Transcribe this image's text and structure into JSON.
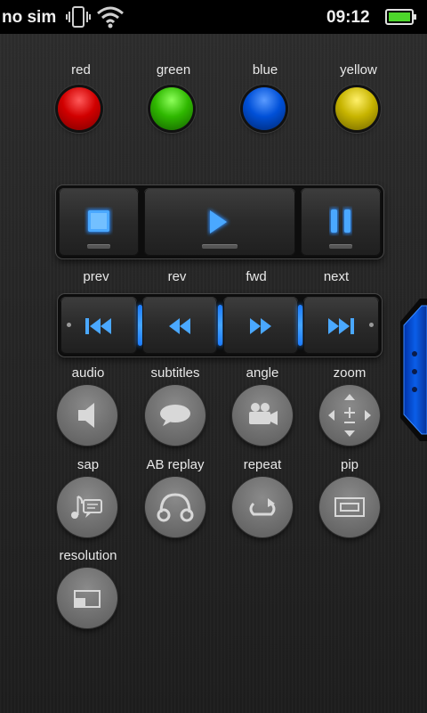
{
  "status_bar": {
    "carrier": "no sim",
    "time": "09:12",
    "icons": [
      "vibrate-icon",
      "wifi-icon",
      "battery-icon"
    ]
  },
  "color_keys": [
    {
      "label": "red",
      "color": "#d10000"
    },
    {
      "label": "green",
      "color": "#2fb800"
    },
    {
      "label": "blue",
      "color": "#0050d8"
    },
    {
      "label": "yellow",
      "color": "#c7b400"
    }
  ],
  "playback": {
    "buttons": [
      "stop",
      "play",
      "pause"
    ]
  },
  "skip": {
    "labels": [
      "prev",
      "rev",
      "fwd",
      "next"
    ]
  },
  "functions_row1": [
    {
      "label": "audio",
      "icon": "speaker-icon"
    },
    {
      "label": "subtitles",
      "icon": "speech-bubble-icon"
    },
    {
      "label": "angle",
      "icon": "camera-icon"
    },
    {
      "label": "zoom",
      "icon": "zoom-dpad-icon"
    }
  ],
  "functions_row2": [
    {
      "label": "sap",
      "icon": "music-note-icon"
    },
    {
      "label": "AB replay",
      "icon": "headphones-icon"
    },
    {
      "label": "repeat",
      "icon": "repeat-icon"
    },
    {
      "label": "pip",
      "icon": "pip-icon"
    }
  ],
  "functions_row3": [
    {
      "label": "resolution",
      "icon": "resolution-icon"
    }
  ],
  "colors": {
    "accent_blue": "#2b8cff",
    "button_grey": "#777777"
  }
}
